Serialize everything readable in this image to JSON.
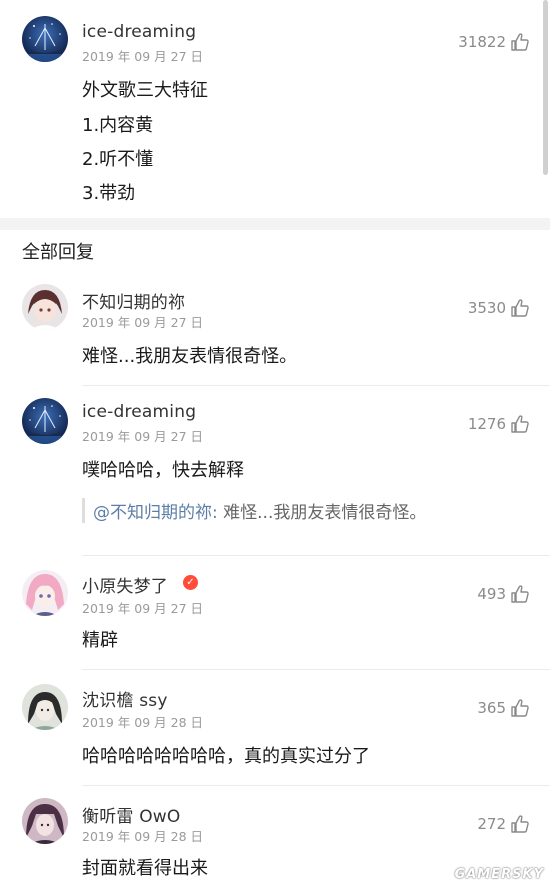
{
  "top_comment": {
    "username": "ice-dreaming",
    "date": "2019 年 09 月 27 日",
    "likes": "31822",
    "lines": [
      "外文歌三大特征",
      "1.内容黄",
      "2.听不懂",
      "3.带劲"
    ]
  },
  "replies_section": {
    "title": "全部回复"
  },
  "replies": [
    {
      "username": "不知归期的祢",
      "date": "2019 年 09 月 27 日",
      "likes": "3530",
      "text": "难怪...我朋友表情很奇怪。"
    },
    {
      "username": "ice-dreaming",
      "date": "2019 年 09 月 27 日",
      "likes": "1276",
      "text": "噗哈哈哈，快去解释",
      "quote": {
        "user": "@不知归期的祢:",
        "text": " 难怪...我朋友表情很奇怪。"
      }
    },
    {
      "username": "小原失梦了",
      "date": "2019 年 09 月 27 日",
      "likes": "493",
      "text": "精辟",
      "badge": "✓"
    },
    {
      "username": "沈识檐 ssy",
      "date": "2019 年 09 月 28 日",
      "likes": "365",
      "text": "哈哈哈哈哈哈哈哈，真的真实过分了"
    },
    {
      "username": "衡听雷 OwO",
      "date": "2019 年 09 月 28 日",
      "likes": "272",
      "text": "封面就看得出来"
    }
  ],
  "icons": {
    "like": "thumbs-up-icon",
    "verified": "verified-badge-icon"
  },
  "colors": {
    "quote_user": "#5b7ea8",
    "badge": "#ff4d3a",
    "divider": "#ebebeb"
  },
  "watermark": "GAMERSKY"
}
